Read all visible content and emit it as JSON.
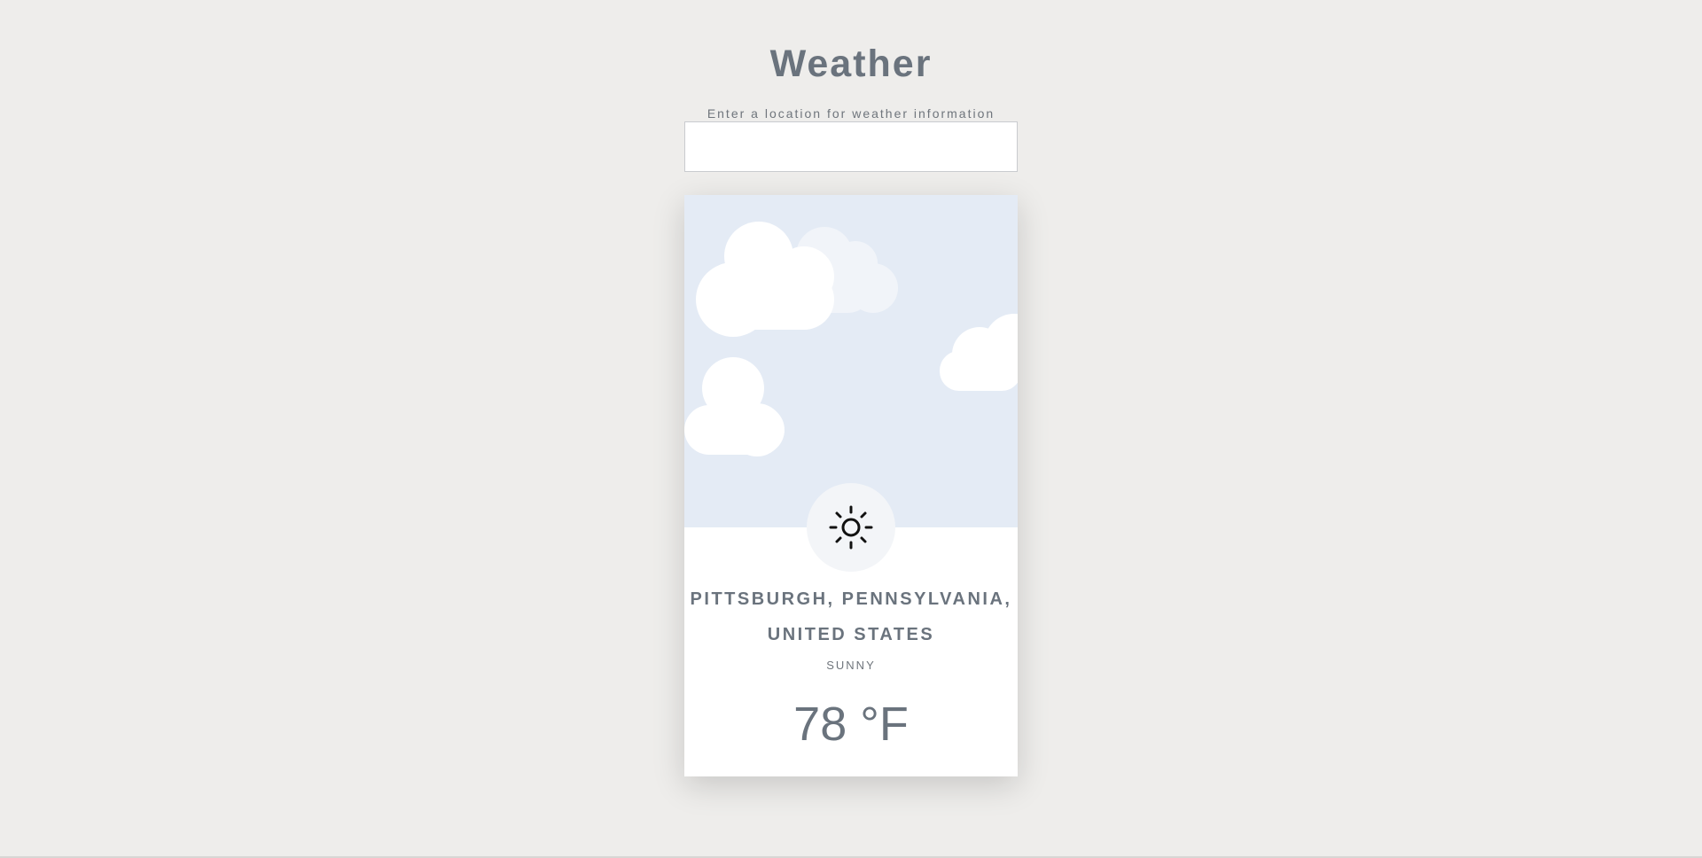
{
  "app": {
    "title": "Weather"
  },
  "search": {
    "label": "Enter a location for weather information",
    "value": "",
    "placeholder": ""
  },
  "weather": {
    "location": "Pittsburgh, Pennsylvania, United States",
    "condition": "Sunny",
    "temperature": "78 °F",
    "icon": "sun-icon"
  },
  "colors": {
    "background": "#eeedeb",
    "sky": "#e4ebf5",
    "text": "#6a737d",
    "card": "#ffffff"
  }
}
